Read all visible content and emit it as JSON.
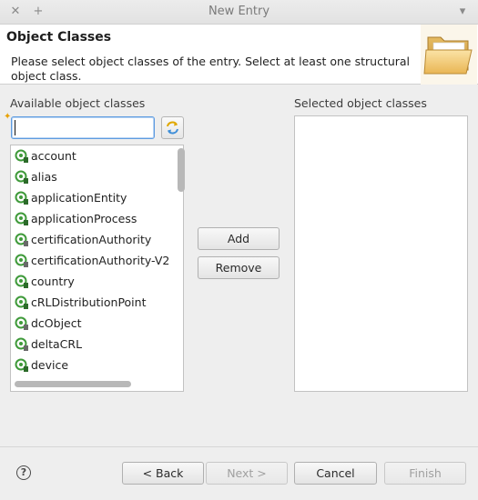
{
  "window": {
    "title": "New Entry",
    "close_glyph": "✕",
    "pin_glyph": "+",
    "menu_glyph": "▾"
  },
  "banner": {
    "title": "Object Classes",
    "message": "Please select object classes of the entry. Select at least one structural object class.",
    "icon": "folder-icon"
  },
  "available": {
    "label": "Available object classes",
    "filter_value": "",
    "items": [
      {
        "label": "account",
        "icon": "structural-class-icon"
      },
      {
        "label": "alias",
        "icon": "structural-class-icon"
      },
      {
        "label": "applicationEntity",
        "icon": "structural-class-icon"
      },
      {
        "label": "applicationProcess",
        "icon": "structural-class-icon"
      },
      {
        "label": "certificationAuthority",
        "icon": "auxiliary-class-icon"
      },
      {
        "label": "certificationAuthority-V2",
        "icon": "auxiliary-class-icon"
      },
      {
        "label": "country",
        "icon": "structural-class-icon"
      },
      {
        "label": "cRLDistributionPoint",
        "icon": "structural-class-icon"
      },
      {
        "label": "dcObject",
        "icon": "auxiliary-class-icon"
      },
      {
        "label": "deltaCRL",
        "icon": "auxiliary-class-icon"
      },
      {
        "label": "device",
        "icon": "structural-class-icon"
      }
    ]
  },
  "actions": {
    "add_label": "Add",
    "remove_label": "Remove"
  },
  "selected": {
    "label": "Selected object classes",
    "items": []
  },
  "footer": {
    "help_glyph": "?",
    "back_label": "< Back",
    "next_label": "Next >",
    "cancel_label": "Cancel",
    "finish_label": "Finish"
  },
  "colors": {
    "accent": "#5d9be0",
    "icon_green": "#3f9a3a"
  }
}
